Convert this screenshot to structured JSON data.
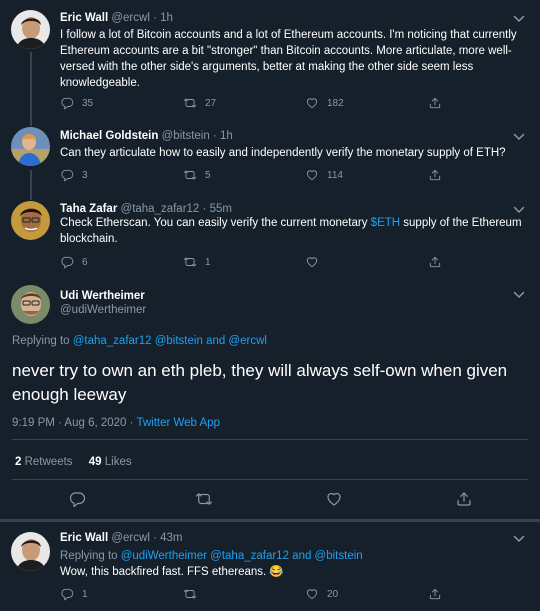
{
  "tweets": [
    {
      "name": "Eric Wall",
      "handle": "@ercwl",
      "time": "1h",
      "text": "I follow a lot of Bitcoin accounts and a lot of Ethereum accounts. I'm noticing that currently Ethereum accounts are a bit \"stronger\" than Bitcoin accounts. More articulate, more well-versed with the other side's arguments, better at making the other side seem less knowledgeable.",
      "replies": "35",
      "retweets": "27",
      "likes": "182"
    },
    {
      "name": "Michael Goldstein",
      "handle": "@bitstein",
      "time": "1h",
      "text": "Can they articulate how to easily and independently verify the monetary supply of ETH?",
      "replies": "3",
      "retweets": "5",
      "likes": "114"
    },
    {
      "name": "Taha Zafar",
      "handle": "@taha_zafar12",
      "time": "55m",
      "text_before": "Check Etherscan. You can easily verify the current monetary ",
      "cashtag": "$ETH",
      "text_after": " supply of the Ethereum blockchain.",
      "replies": "6",
      "retweets": "1",
      "likes": ""
    }
  ],
  "main_tweet": {
    "name": "Udi Wertheimer",
    "handle": "@udiWertheimer",
    "replying_prefix": "Replying to ",
    "replying_to": "@taha_zafar12 @bitstein and @ercwl",
    "text": "never try to own an eth pleb, they will always self-own when given enough leeway",
    "timestamp": "9:19 PM · Aug 6, 2020 · ",
    "client": "Twitter Web App",
    "retweet_count": "2",
    "retweet_label": "Retweets",
    "like_count": "49",
    "like_label": "Likes"
  },
  "reply": {
    "name": "Eric Wall",
    "handle": "@ercwl",
    "time": "43m",
    "replying_prefix": "Replying to ",
    "replying_to": "@udiWertheimer @taha_zafar12 and @bitstein",
    "text": "Wow, this backfired fast. FFS ethereans. 😂",
    "replies": "1",
    "retweets": "",
    "likes": "20"
  },
  "colors": {
    "background": "#15202b",
    "secondary_text": "#8899a6",
    "link": "#1da1f2",
    "divider": "#38444d"
  },
  "icons": [
    "reply-icon",
    "retweet-icon",
    "like-icon",
    "share-icon",
    "caret-down-icon"
  ]
}
